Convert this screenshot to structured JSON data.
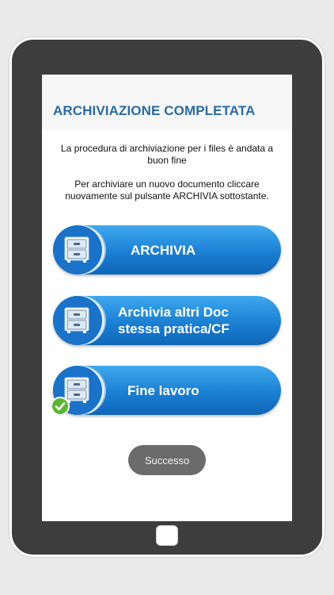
{
  "dialog": {
    "title": "ARCHIVIAZIONE COMPLETATA",
    "message_1": "La procedura di archiviazione per i files è andata a buon fine",
    "message_2": "Per archiviare un nuovo documento cliccare nuovamente sul pulsante ARCHIVIA sottostante."
  },
  "buttons": {
    "archivia": {
      "line1": "ARCHIVIA",
      "icon": "file-cabinet-icon"
    },
    "archivia_altri": {
      "line1": "Archivia altri Doc",
      "line2": "stessa pratica/CF",
      "icon": "file-cabinet-icon"
    },
    "fine_lavoro": {
      "line1": "Fine lavoro",
      "icon": "file-cabinet-icon",
      "badge_icon": "checkmark-icon"
    }
  },
  "toast": {
    "text": "Successo"
  },
  "colors": {
    "title": "#2a6aa5",
    "button_blue": "#1b7fd3",
    "check_green": "#5cb531",
    "toast_bg": "#6b6b6b",
    "tablet_frame": "#3d3d3d"
  }
}
